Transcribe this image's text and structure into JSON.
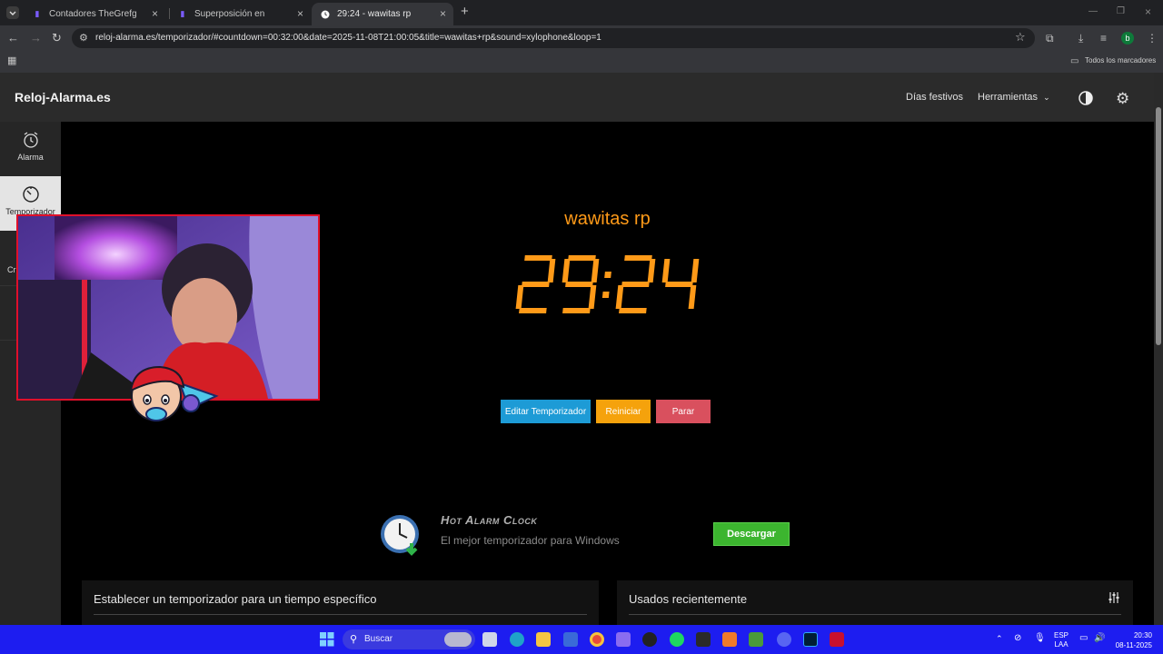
{
  "browser": {
    "tabs": [
      {
        "title": "Contadores TheGrefg"
      },
      {
        "title": "Superposición en"
      },
      {
        "title": "29:24 - wawitas rp"
      }
    ],
    "url": "reloj-alarma.es/temporizador/#countdown=00:32:00&date=2025-11-08T21:00:05&title=wawitas+rp&sound=xylophone&loop=1",
    "bookmarks_label": "Todos los marcadores",
    "profile_initial": "b"
  },
  "site": {
    "logo": "Reloj-Alarma.es",
    "nav": {
      "holidays": "Días festivos",
      "tools": "Herramientas"
    }
  },
  "sidebar": {
    "items": [
      {
        "label": "Alarma"
      },
      {
        "label": "Temporizador"
      },
      {
        "label": "Cr"
      }
    ]
  },
  "timer": {
    "title": "wawitas rp",
    "display": "29:24",
    "minutes": "29",
    "seconds": "24",
    "edit_label": "Editar Temporizador",
    "restart_label": "Reiniciar",
    "stop_label": "Parar"
  },
  "ad": {
    "brand": "Hot Alarm Clock",
    "tagline": "El mejor temporizador para Windows",
    "download_label": "Descargar"
  },
  "cards": {
    "specific_time": "Establecer un temporizador para un tiempo específico",
    "recent": "Usados recientemente"
  },
  "taskbar": {
    "search_placeholder": "Buscar",
    "lang": "ESP",
    "lang_sub": "LAA",
    "time": "20:30",
    "date": "08-11-2025"
  },
  "colors": {
    "accent_orange": "#ff9a18",
    "edit_btn": "#1d9bd6",
    "restart_btn": "#f5a20c",
    "stop_btn": "#d9505e",
    "download_btn": "#3cb52f",
    "taskbar": "#1d1df0",
    "webcam_border": "#e0102a"
  }
}
